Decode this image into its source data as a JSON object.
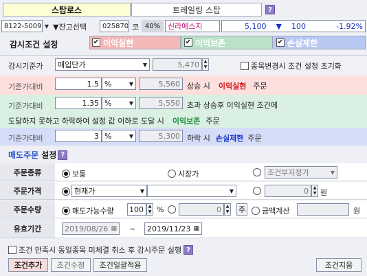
{
  "tabs": {
    "active": "스탑로스",
    "inactive": "트레일링 스탑",
    "help": "?"
  },
  "stock": {
    "account": "8122-5009",
    "balance_select": "▼잔고선택",
    "code": "025870",
    "market": "코",
    "margin": "40%",
    "name": "신라에스지",
    "price": "5,100",
    "direction_icon": "▼",
    "change": "100",
    "change_rate": "-1.92%"
  },
  "monitor": {
    "title": "감시조건 설정",
    "profit_take": "이익실현",
    "profit_keep": "이익보존",
    "stop_loss": "손실제한"
  },
  "base": {
    "label": "감시기준가",
    "type": "매입단가",
    "price": "5,470",
    "reset_label": "종목변경시 조건 설정 초기화"
  },
  "cond1": {
    "label": "기준가대비",
    "value": "1.5",
    "unit": "%",
    "price": "5,560",
    "text_pre": "상승 시",
    "emph": "이익실현",
    "text_post": "주문"
  },
  "cond2": {
    "label": "기준가대비",
    "value": "1.35",
    "unit": "%",
    "price": "5,550",
    "text_pre": "초과 상승후 이익실현 조건에",
    "line2_pre": "도달하지 못하고 하락하여 설정 값 이하로 도달 시",
    "emph": "이익보존",
    "text_post": "주문"
  },
  "cond3": {
    "label": "기준가대비",
    "value": "3",
    "unit": "%",
    "price": "5,300",
    "text_pre": "하락 시",
    "emph": "손실제한",
    "text_post": "주문"
  },
  "sell": {
    "title_colored": "매도주문",
    "title_rest": "설정"
  },
  "order_type": {
    "label": "주문종류",
    "opt1": "보통",
    "opt2": "시장가",
    "opt3": "조건부지정가"
  },
  "order_price": {
    "label": "주문가격",
    "select": "현재가",
    "value": "0",
    "unit": "원"
  },
  "order_qty": {
    "label": "주문수량",
    "opt1": "매도가능수량",
    "pct": "100",
    "pct_unit": "%",
    "qty": "0",
    "qty_unit": "주",
    "opt3": "금액계산",
    "amt_unit": "원"
  },
  "validity": {
    "label": "유효기간",
    "from": "2019/08/26",
    "sep": "~",
    "to": "2019/11/23"
  },
  "footer": {
    "cancel_text": "조건 만족시 동일종목 미체결 취소 후 감시주문 실행",
    "add": "조건추가",
    "edit": "조건수정",
    "apply_all": "조건일괄적용",
    "delete": "조건지움"
  },
  "colors": {
    "pink": "#f4b8b8",
    "green": "#b9e2c7",
    "blue": "#b8c8f2",
    "pink_bg": "#fde0de",
    "green_bg": "#d9f0e2",
    "blue_bg": "#d5dcf7",
    "red_text": "#d0141a",
    "green_text": "#1a8a3a",
    "blue_text": "#1a35c8"
  }
}
